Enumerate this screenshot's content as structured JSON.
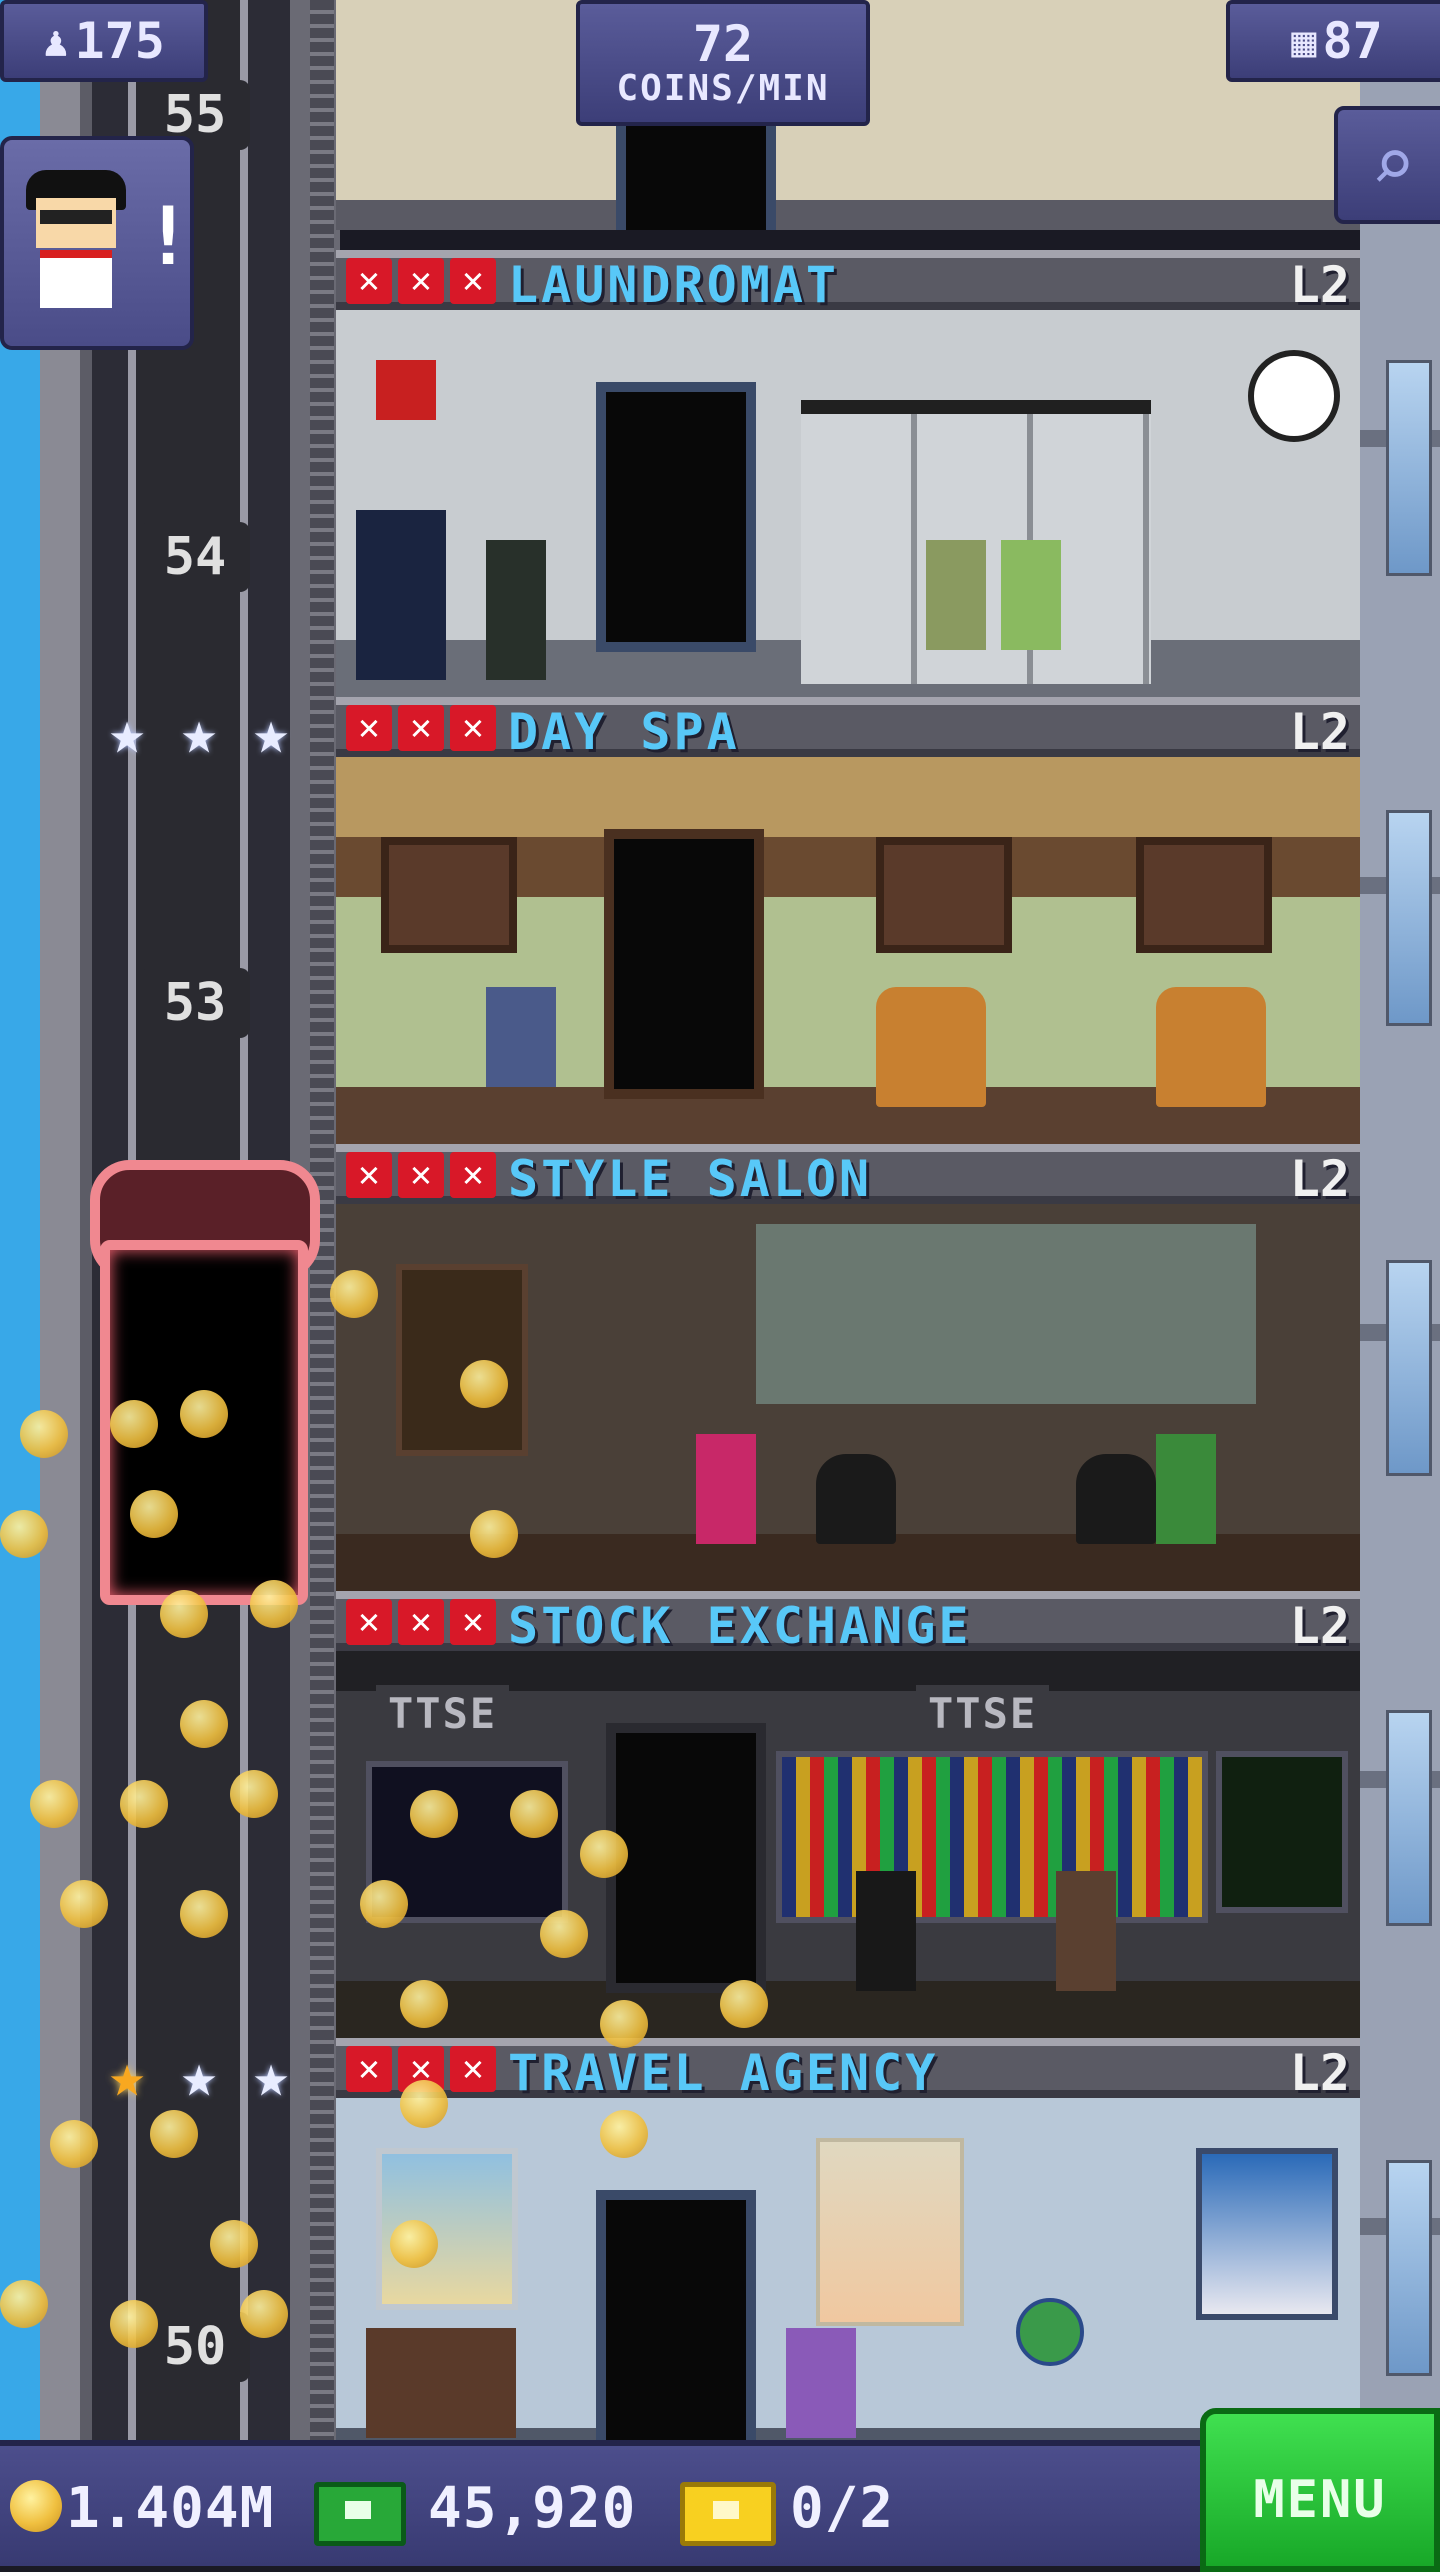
{
  "topbar": {
    "population": "175",
    "income_value": "72",
    "income_label": "COINS/MIN",
    "floors": "87"
  },
  "shaft": {
    "floor_numbers": [
      "55",
      "54",
      "53",
      "50"
    ]
  },
  "floors": [
    {
      "name": "LAUNDROMAT",
      "level": "L2"
    },
    {
      "name": "DAY SPA",
      "level": "L2"
    },
    {
      "name": "STYLE SALON",
      "level": "L2"
    },
    {
      "name": "STOCK EXCHANGE",
      "level": "L2"
    },
    {
      "name": "TRAVEL AGENCY",
      "level": "L2"
    }
  ],
  "stock_signs": [
    "TTSE",
    "TTSE"
  ],
  "bottombar": {
    "coins": "1.404M",
    "bux": "45,920",
    "tickets": "0/2",
    "menu_label": "MENU"
  },
  "icons": {
    "population": "person-icon",
    "floors": "building-icon",
    "search": "magnifier-icon",
    "coin": "coin-icon",
    "bux": "bux-icon",
    "ticket": "ticket-icon"
  }
}
